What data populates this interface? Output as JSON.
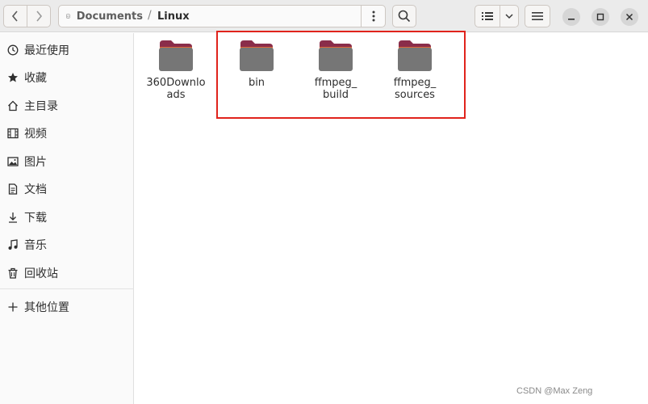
{
  "pathbar": {
    "segments": [
      "Documents",
      "Linux"
    ],
    "separator": "/"
  },
  "sidebar": {
    "items": [
      {
        "label": "最近使用",
        "icon": "clock-icon"
      },
      {
        "label": "收藏",
        "icon": "star-icon"
      },
      {
        "label": "主目录",
        "icon": "home-icon"
      },
      {
        "label": "视频",
        "icon": "film-icon"
      },
      {
        "label": "图片",
        "icon": "image-icon"
      },
      {
        "label": "文档",
        "icon": "document-icon"
      },
      {
        "label": "下载",
        "icon": "download-icon"
      },
      {
        "label": "音乐",
        "icon": "music-icon"
      },
      {
        "label": "回收站",
        "icon": "trash-icon"
      }
    ],
    "other": {
      "label": "其他位置",
      "icon": "plus-icon"
    }
  },
  "files": [
    {
      "name": "360Downloads",
      "line1": "360Downlo",
      "line2": "ads"
    },
    {
      "name": "bin",
      "line1": "bin",
      "line2": ""
    },
    {
      "name": "ffmpeg_build",
      "line1": "ffmpeg_",
      "line2": "build"
    },
    {
      "name": "ffmpeg_sources",
      "line1": "ffmpeg_",
      "line2": "sources"
    }
  ],
  "colors": {
    "folder_body": "#767676",
    "folder_tab": "#8a2d4a",
    "folder_accent": "#e0673a",
    "highlight": "#e0231c"
  },
  "watermark": "CSDN @Max Zeng"
}
